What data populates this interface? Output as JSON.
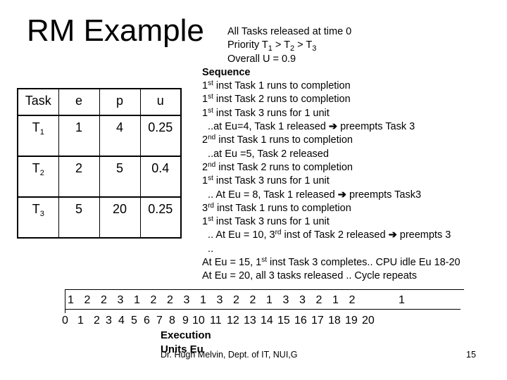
{
  "slide": {
    "title": "RM Example",
    "page_number": "15",
    "footer": "Dr. Hugh Melvin, Dept. of IT, NUI,G"
  },
  "table": {
    "headers": [
      "Task",
      "e",
      "p",
      "u"
    ],
    "rows": [
      {
        "task": "T",
        "task_sub": "1",
        "e": "1",
        "p": "4",
        "u": "0.25"
      },
      {
        "task": "T",
        "task_sub": "2",
        "e": "2",
        "p": "5",
        "u": "0.4"
      },
      {
        "task": "T",
        "task_sub": "3",
        "e": "5",
        "p": "20",
        "u": "0.25"
      }
    ]
  },
  "notes": {
    "intro": [
      "All Tasks released at time 0",
      "Priority",
      "Overall U = 0.9"
    ],
    "priority": {
      "t": "T",
      "subs": [
        "1",
        "2",
        "3"
      ],
      "sep": " > "
    },
    "sequence_heading": "Sequence",
    "lines": [
      {
        "pre": "1",
        "sup": "st",
        "text": " inst Task 1 runs to completion"
      },
      {
        "pre": "1",
        "sup": "st",
        "text": " inst Task 2 runs to completion"
      },
      {
        "pre": "1",
        "sup": "st",
        "text": " inst Task 3 runs for 1 unit"
      },
      {
        "pre": "  ..at Eu=4, Task 1 released ",
        "arrow": "➔",
        "text": " preempts Task 3"
      },
      {
        "pre": "2",
        "sup": "nd",
        "text": " inst Task 1 runs to completion"
      },
      {
        "pre": "  ..at Eu =5, Task 2 released"
      },
      {
        "pre": "2",
        "sup": "nd",
        "text": " inst Task 2 runs to completion"
      },
      {
        "pre": "1",
        "sup": "st",
        "text": " inst Task 3 runs for 1 unit"
      },
      {
        "pre": "  .. At Eu = 8, Task 1 released ",
        "arrow": "➔",
        "text": " preempts Task3"
      },
      {
        "pre": "3",
        "sup": "rd",
        "text": " inst Task 1 runs to completion"
      },
      {
        "pre": "1",
        "sup": "st",
        "text": " inst Task 3 runs for 1 unit"
      },
      {
        "pre": "  .. At Eu = 10, 3",
        "sup": "rd",
        "text": " inst of Task 2 released ",
        "arrow2": "➔",
        "text2": " preempts 3"
      },
      {
        "pre": "  .."
      },
      {
        "pre": "At Eu = 15, 1",
        "sup": "st",
        "text": " inst Task 3 completes.. CPU idle Eu 18-20"
      },
      {
        "pre": "At Eu = 20, all 3 tasks released .. Cycle repeats"
      }
    ]
  },
  "timeline": {
    "tasks": [
      "1",
      "2",
      "2",
      "3",
      "1",
      "2",
      "2",
      "3",
      "1",
      "3",
      "2",
      "2",
      "1",
      "3",
      "3",
      "2",
      "1",
      "2",
      "",
      "",
      "1"
    ],
    "ticks": [
      "0",
      "1",
      "2",
      "3",
      "4",
      "5",
      "6",
      "7",
      "8",
      "9",
      "10",
      "11",
      "12",
      "13",
      "14",
      "15",
      "16",
      "17",
      "18",
      "19",
      "20"
    ],
    "caption": "Execution Units Eu"
  }
}
